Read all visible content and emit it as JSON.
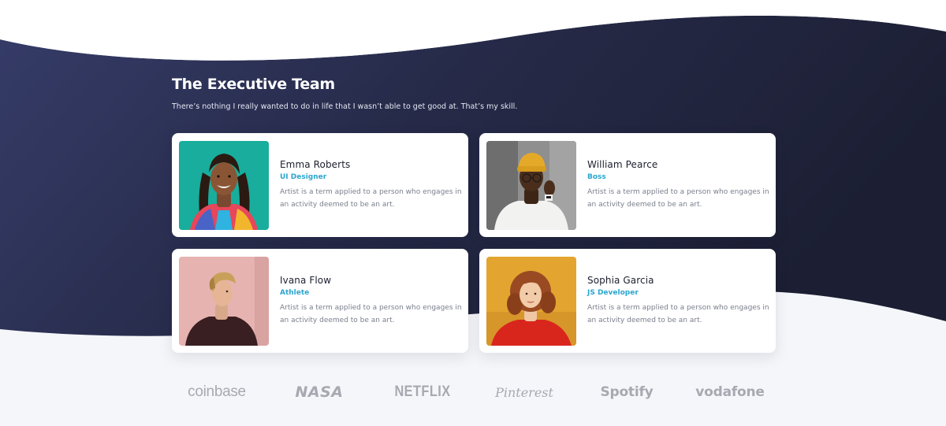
{
  "section": {
    "title": "The Executive Team",
    "subtitle": "There’s nothing I really wanted to do in life that I wasn’t able to get good at. That’s my skill."
  },
  "team": [
    {
      "name": "Emma Roberts",
      "role": "UI Designer",
      "description": "Artist is a term applied to a person who engages in an activity deemed to be an art."
    },
    {
      "name": "William Pearce",
      "role": "Boss",
      "description": "Artist is a term applied to a person who engages in an activity deemed to be an art."
    },
    {
      "name": "Ivana Flow",
      "role": "Athlete",
      "description": "Artist is a term applied to a person who engages in an activity deemed to be an art."
    },
    {
      "name": "Sophia Garcia",
      "role": "JS Developer",
      "description": "Artist is a term applied to a person who engages in an activity deemed to be an art."
    }
  ],
  "logos": [
    "coinbase",
    "NASA",
    "NETFLIX",
    "Pinterest",
    "Spotify",
    "vodafone"
  ],
  "colors": {
    "wave_start": "#333a66",
    "wave_end": "#1c1f33",
    "accent": "#2ba6cf",
    "page_background": "#f5f6f9",
    "card_background": "#ffffff"
  }
}
